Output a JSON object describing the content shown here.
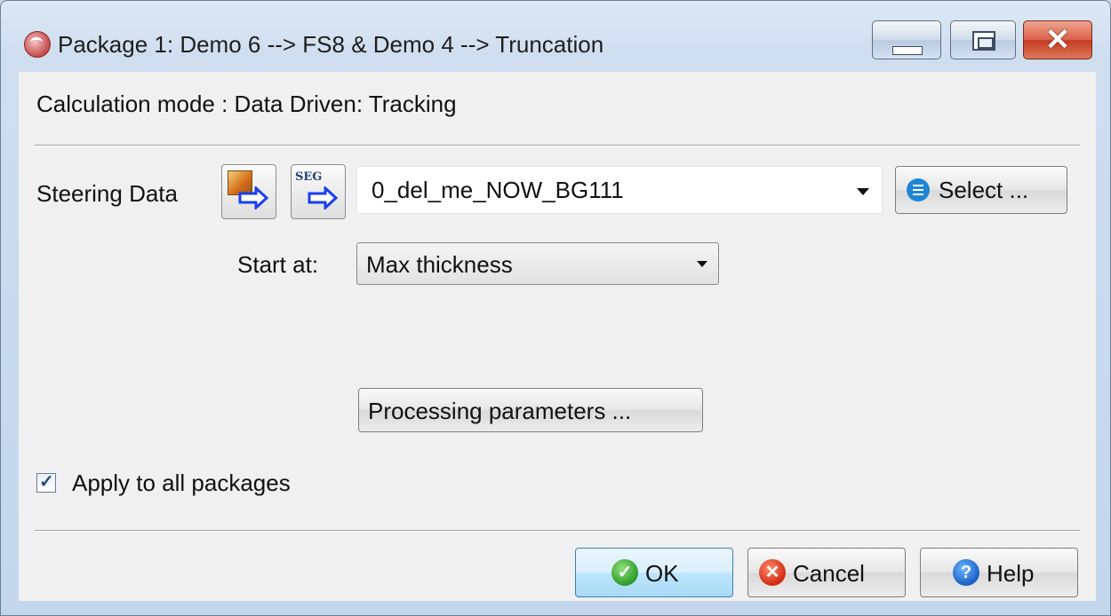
{
  "window": {
    "title": "Package 1: Demo 6 --> FS8 & Demo 4 --> Truncation",
    "close_glyph": "✕"
  },
  "mode": {
    "text": "Calculation mode : Data Driven: Tracking"
  },
  "steering": {
    "label": "Steering Data",
    "seg_text": "SEG",
    "value": "0_del_me_NOW_BG111",
    "select_label": "Select ..."
  },
  "start": {
    "label": "Start at:",
    "value": "Max thickness"
  },
  "processing": {
    "label": "Processing parameters ..."
  },
  "apply": {
    "checked": true,
    "check_glyph": "✓",
    "label": "Apply to all packages"
  },
  "buttons": {
    "ok": "OK",
    "ok_glyph": "✓",
    "cancel": "Cancel",
    "cancel_glyph": "✕",
    "help": "Help",
    "help_glyph": "?"
  },
  "colors": {
    "arrow_blue": "#1a3ef0"
  }
}
